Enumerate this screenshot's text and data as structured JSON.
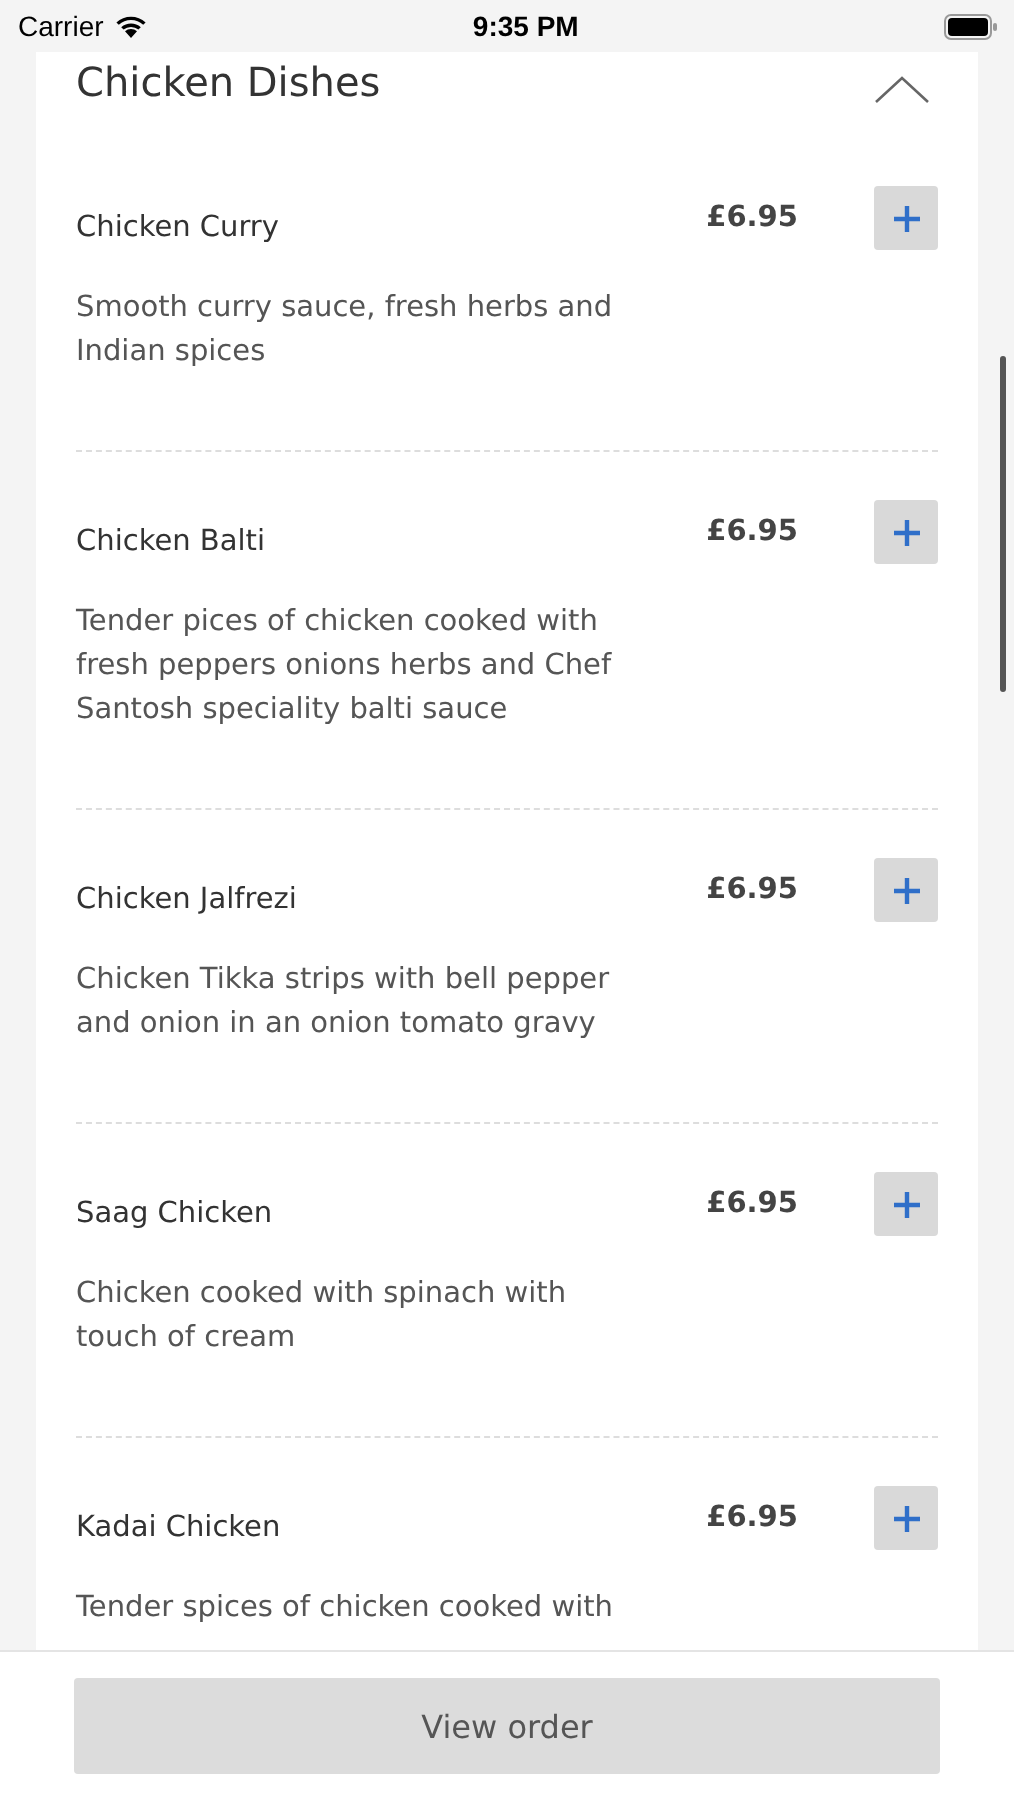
{
  "status_bar": {
    "carrier": "Carrier",
    "time": "9:35 PM"
  },
  "section": {
    "title": "Chicken Dishes",
    "expanded": true
  },
  "items": [
    {
      "name": "Chicken Curry",
      "price": "£6.95",
      "description": "Smooth curry sauce, fresh herbs and Indian spices"
    },
    {
      "name": "Chicken Balti",
      "price": "£6.95",
      "description": "Tender pices of chicken cooked with fresh peppers onions herbs and Chef Santosh speciality balti sauce"
    },
    {
      "name": "Chicken Jalfrezi",
      "price": "£6.95",
      "description": "Chicken Tikka strips with bell pepper and onion in an onion tomato gravy"
    },
    {
      "name": "Saag Chicken",
      "price": "£6.95",
      "description": "Chicken cooked with spinach with touch of cream"
    },
    {
      "name": "Kadai Chicken",
      "price": "£6.95",
      "description": "Tender spices of chicken cooked with"
    }
  ],
  "footer": {
    "button": "View order"
  }
}
